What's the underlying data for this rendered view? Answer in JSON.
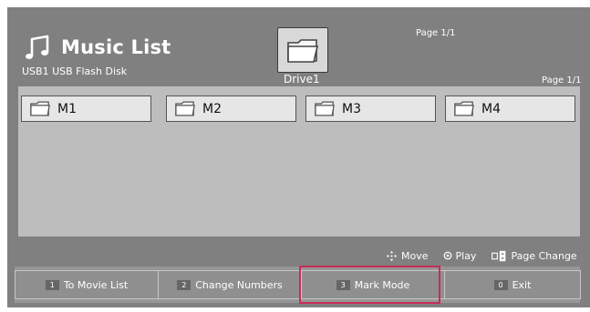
{
  "header": {
    "title": "Music List",
    "device_label": "USB1 USB Flash Disk",
    "drive_label": "Drive1",
    "page_top": "Page 1/1",
    "page_right": "Page 1/1"
  },
  "folders": [
    {
      "label": "M1",
      "icon": "folder-icon"
    },
    {
      "label": "M2",
      "icon": "folder-icon"
    },
    {
      "label": "M3",
      "icon": "folder-icon"
    },
    {
      "label": "M4",
      "icon": "folder-icon"
    }
  ],
  "legend": [
    {
      "label": "Move",
      "icon": "move-arrows-icon"
    },
    {
      "label": "Play",
      "icon": "play-dot-icon"
    },
    {
      "label": "Page Change",
      "icon": "page-change-icon"
    }
  ],
  "bottom_buttons": [
    {
      "num": "1",
      "label": "To Movie List"
    },
    {
      "num": "2",
      "label": "Change Numbers"
    },
    {
      "num": "3",
      "label": "Mark Mode"
    },
    {
      "num": "0",
      "label": "Exit"
    }
  ],
  "colors": {
    "screen_background": "#808080",
    "panel_background": "#bdbdbd",
    "folder_tile_background": "#e6e6e6",
    "highlight_border": "#c82d58"
  }
}
